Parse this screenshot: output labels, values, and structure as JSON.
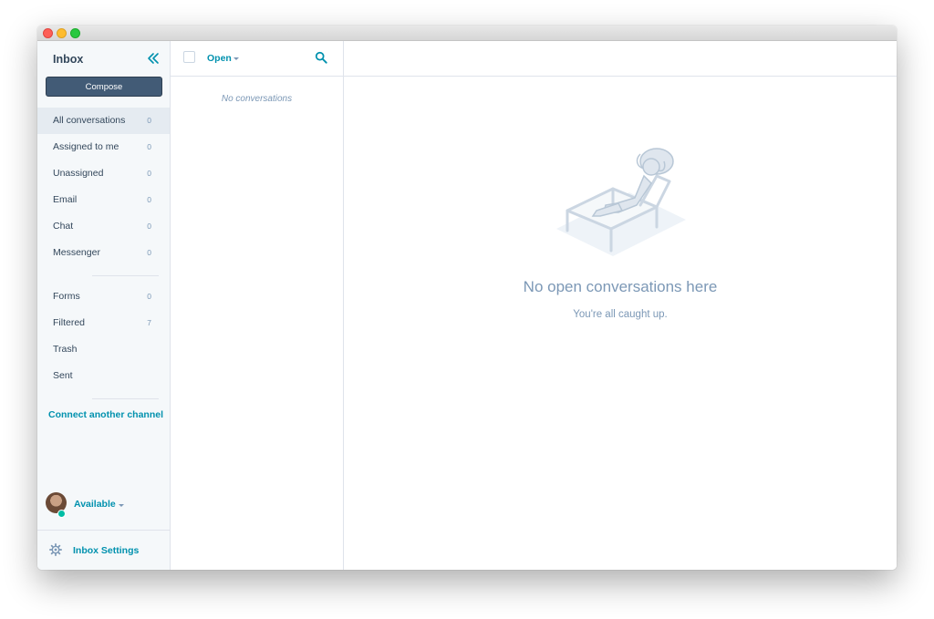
{
  "sidebar": {
    "title": "Inbox",
    "compose_label": "Compose",
    "nav": [
      {
        "label": "All conversations",
        "count": "0"
      },
      {
        "label": "Assigned to me",
        "count": "0"
      },
      {
        "label": "Unassigned",
        "count": "0"
      },
      {
        "label": "Email",
        "count": "0"
      },
      {
        "label": "Chat",
        "count": "0"
      },
      {
        "label": "Messenger",
        "count": "0"
      }
    ],
    "nav2": [
      {
        "label": "Forms",
        "count": "0"
      },
      {
        "label": "Filtered",
        "count": "7"
      },
      {
        "label": "Trash",
        "count": ""
      },
      {
        "label": "Sent",
        "count": ""
      }
    ],
    "connect_label": "Connect another channel",
    "status_label": "Available",
    "settings_label": "Inbox Settings"
  },
  "list": {
    "filter_label": "Open",
    "empty_text": "No conversations"
  },
  "main": {
    "empty_title": "No open conversations here",
    "empty_subtitle": "You're all caught up."
  },
  "colors": {
    "accent": "#0091ae",
    "compose_bg": "#425b76",
    "muted_text": "#7c98b6",
    "sidebar_bg": "#f5f8fa",
    "status_online": "#00bda5"
  },
  "icons": [
    "collapse-icon",
    "search-icon",
    "gear-icon",
    "chevron-down-icon"
  ]
}
